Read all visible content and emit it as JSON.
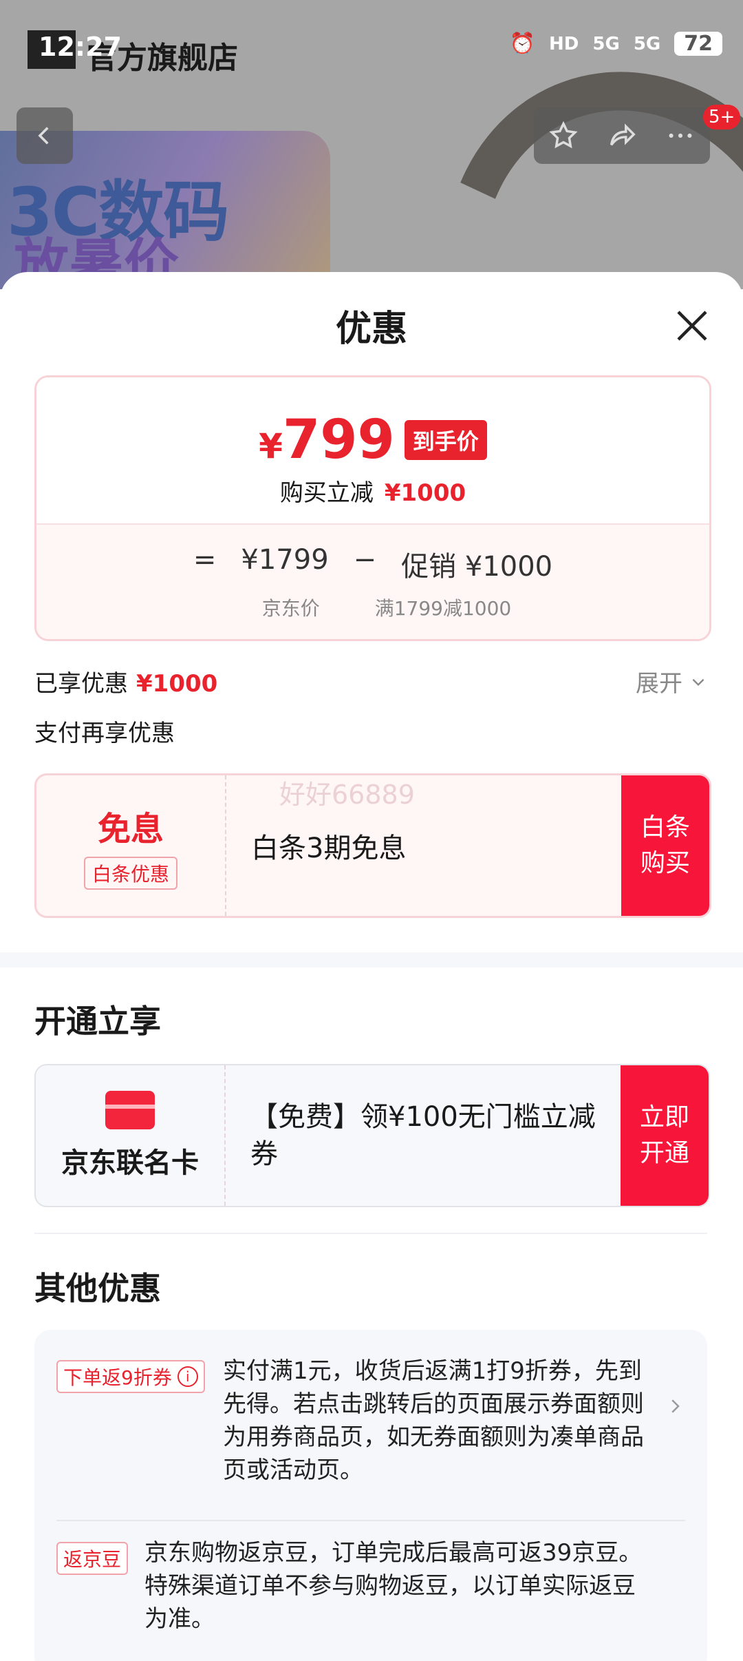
{
  "status_bar": {
    "time": "12:27",
    "hd": "HD",
    "sig1": "5G",
    "sig2": "5G",
    "battery": "72"
  },
  "background": {
    "store_name": "官方旗舰店",
    "promo_line1": "3C数码",
    "promo_line2": "放暑价",
    "badge": "5+"
  },
  "sheet": {
    "title": "优惠"
  },
  "price_card": {
    "yen": "¥",
    "final_price": "799",
    "final_tag": "到手价",
    "reduce_label": "购买立减",
    "reduce_value": "¥1000",
    "eq": "=",
    "jd_price": "¥1799",
    "minus": "−",
    "promo_label": "促销",
    "promo_value": "¥1000",
    "jd_price_label": "京东价",
    "promo_rule": "满1799减1000"
  },
  "enjoyed": {
    "label": "已享优惠",
    "value": "¥1000",
    "expand": "展开"
  },
  "pay_more": "支付再享优惠",
  "baitiao": {
    "title": "免息",
    "tag": "白条优惠",
    "desc": "白条3期免息",
    "action_line1": "白条",
    "action_line2": "购买",
    "watermark": "好好66889"
  },
  "open_section": {
    "title": "开通立享",
    "card_name": "京东联名卡",
    "desc": "【免费】领¥100无门槛立减券",
    "action_line1": "立即",
    "action_line2": "开通"
  },
  "other_section": {
    "title": "其他优惠",
    "items": [
      {
        "tag": "下单返9折券",
        "text": "实付满1元，收货后返满1打9折券，先到先得。若点击跳转后的页面展示券面额则为用券商品页，如无券面额则为凑单商品页或活动页。"
      },
      {
        "tag": "返京豆",
        "text": "京东购物返京豆，订单完成后最高可返39京豆。特殊渠道订单不参与购物返豆，以订单实际返豆为准。"
      }
    ]
  },
  "colors": {
    "brand_red": "#e8232e",
    "action_red": "#f7163a"
  }
}
